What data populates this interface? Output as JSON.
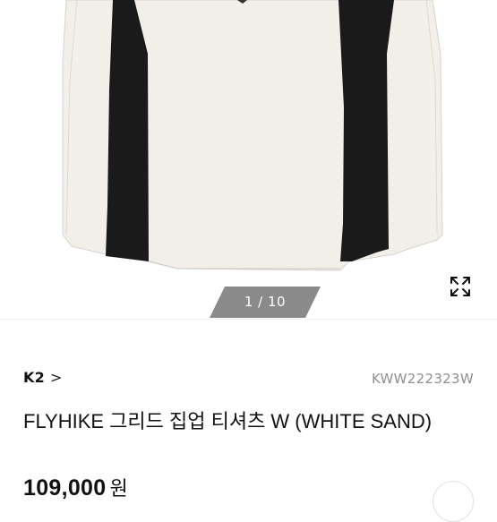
{
  "gallery": {
    "counter": "1 / 10",
    "expand_icon": "expand-arrows-icon"
  },
  "product": {
    "brand": "K2",
    "brand_chevron": ">",
    "code": "KWW222323W",
    "title": "FLYHIKE 그리드 집업 티셔츠 W (WHITE SAND)",
    "price": "109,000",
    "price_unit": "원"
  },
  "colors": {
    "garment": "#f2eee8",
    "accent_stripe": "#1a1a1a",
    "counter_bg": "#8a8a8a",
    "code_text": "#8f8f8f"
  }
}
